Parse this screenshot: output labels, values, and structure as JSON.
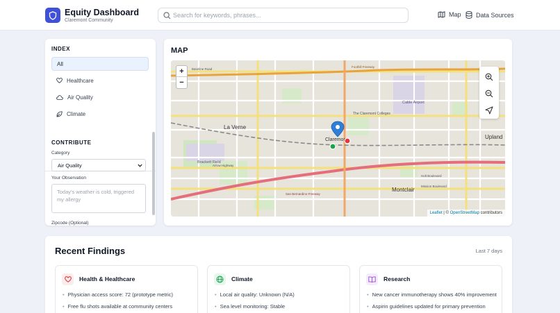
{
  "header": {
    "title": "Equity Dashboard",
    "subtitle": "Claremont Community",
    "search_placeholder": "Search for keywords, phrases...",
    "nav": [
      {
        "label": "Map",
        "icon": "map-icon"
      },
      {
        "label": "Data Sources",
        "icon": "database-icon"
      }
    ]
  },
  "sidebar": {
    "index_title": "INDEX",
    "index_items": [
      {
        "label": "All",
        "icon": "",
        "active": true
      },
      {
        "label": "Healthcare",
        "icon": "heart-icon"
      },
      {
        "label": "Air Quality",
        "icon": "cloud-icon"
      },
      {
        "label": "Climate",
        "icon": "leaf-icon"
      }
    ],
    "contribute_title": "CONTRIBUTE",
    "category_label": "Category",
    "category_value": "Air Quality",
    "observation_label": "Your Observation",
    "observation_placeholder": "Today's weather is cold, triggered my allergy",
    "zipcode_label": "Zipcode (Optional)"
  },
  "map": {
    "title": "MAP",
    "zoom_in": "+",
    "zoom_out": "−",
    "attribution_leaflet": "Leaflet",
    "attribution_sep": " | © ",
    "attribution_osm": "OpenStreetMap",
    "attribution_tail": " contributors",
    "labels": [
      {
        "text": "La Verne"
      },
      {
        "text": "Claremont"
      },
      {
        "text": "Upland"
      },
      {
        "text": "Montclair"
      },
      {
        "text": "Brackett Field"
      },
      {
        "text": "Cable Airport"
      },
      {
        "text": "The Claremont Colleges"
      },
      {
        "text": "Baseline Road"
      },
      {
        "text": "Foothill Freeway"
      },
      {
        "text": "Arrow Highway"
      },
      {
        "text": "San Bernardino Freeway"
      },
      {
        "text": "Holt Boulevard"
      },
      {
        "text": "Mission Boulevard"
      }
    ],
    "marker_colors": {
      "pin": "#2f7fd9",
      "green": "#1aa34a",
      "red": "#e0383e"
    }
  },
  "findings": {
    "title": "Recent Findings",
    "range": "Last 7 days",
    "cards": [
      {
        "title": "Health & Healthcare",
        "icon": "heart-icon",
        "color": "#e0383e",
        "bg": "#fdecec",
        "items": [
          "Physician access score: 72 (prototype metric)",
          "Free flu shots available at community centers"
        ]
      },
      {
        "title": "Climate",
        "icon": "globe-icon",
        "color": "#1aa34a",
        "bg": "#e8f7ee",
        "items": [
          "Local air quality: Unknown (N/A)",
          "Sea level monitoring: Stable"
        ]
      },
      {
        "title": "Research",
        "icon": "book-icon",
        "color": "#9b4bd6",
        "bg": "#f4ecfb",
        "items": [
          "New cancer immunotherapy shows 40% improvement",
          "Aspirin guidelines updated for primary prevention"
        ]
      }
    ]
  }
}
